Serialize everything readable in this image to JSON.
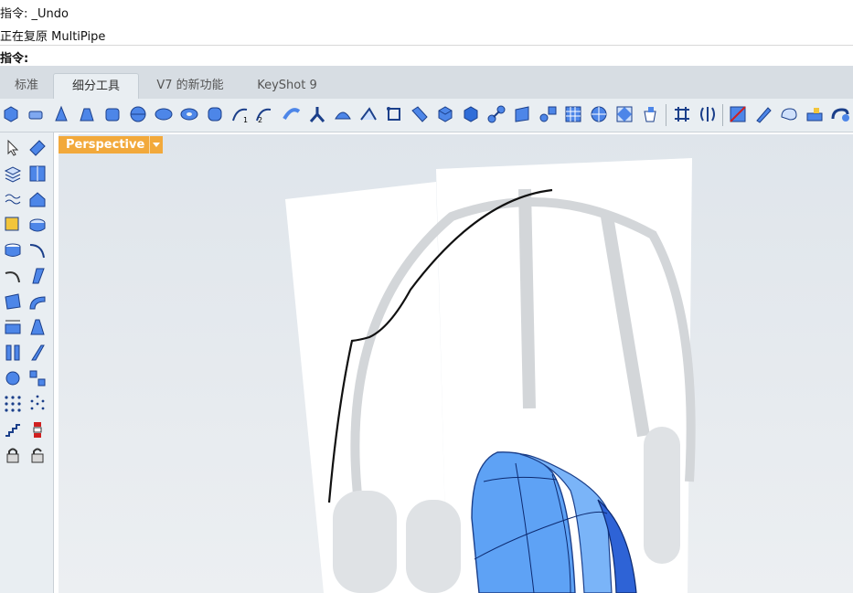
{
  "command": {
    "history_line1": "指令: _Undo",
    "history_line2": "正在复原 MultiPipe",
    "prompt": "指令:"
  },
  "tabs": [
    {
      "label": "标准"
    },
    {
      "label": "细分工具"
    },
    {
      "label": "V7 的新功能"
    },
    {
      "label": "KeyShot 9"
    }
  ],
  "active_tab": "细分工具",
  "toolbar_icons": [
    "box-icon",
    "slab-icon",
    "cone-icon",
    "truncated-cone-icon",
    "cylinder-icon",
    "sphere-icon",
    "ellipsoid-icon",
    "torus-icon",
    "quadball-icon",
    "arc-1-icon",
    "arc-2-icon",
    "sweep-icon",
    "y-branch-icon",
    "patch-icon",
    "fold-icon",
    "append-icon",
    "bridge-icon",
    "cube-icon",
    "box-solid-icon",
    "smooth-icon",
    "plane-grid-icon",
    "insert-edge-icon",
    "grid-icon",
    "sphere-grid-icon",
    "crease-icon",
    "bucket-icon",
    "weld-icon",
    "symmetry-icon",
    "subd-red-icon",
    "pencil-icon",
    "shape-icon",
    "display-icon",
    "toggle-icon"
  ],
  "viewport": {
    "label": "Perspective"
  },
  "colors": {
    "accent": "#f2a93b",
    "subd_blue": "#4a8af0"
  }
}
